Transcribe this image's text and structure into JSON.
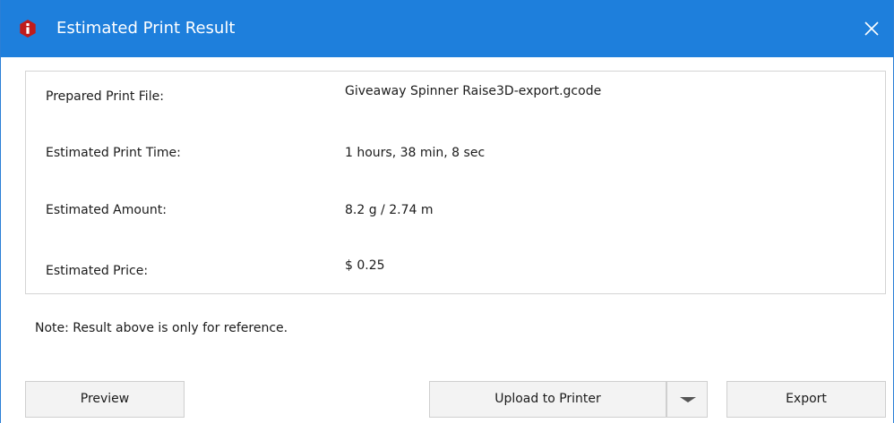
{
  "window": {
    "title": "Estimated Print Result",
    "accent_color": "#1e7fdc",
    "app_icon": "raise3d-logo-icon",
    "close_icon": "close-icon"
  },
  "info": {
    "rows": [
      {
        "label": "Prepared Print File:",
        "value": "Giveaway Spinner Raise3D-export.gcode"
      },
      {
        "label": "Estimated Print Time:",
        "value": "1 hours, 38 min, 8 sec"
      },
      {
        "label": "Estimated Amount:",
        "value": "8.2 g / 2.74 m"
      },
      {
        "label": "Estimated Price:",
        "value": "$ 0.25"
      }
    ]
  },
  "note": "Note: Result above is only for reference.",
  "buttons": {
    "preview": "Preview",
    "upload": "Upload to Printer",
    "dropdown_icon": "chevron-down-icon",
    "export": "Export"
  }
}
